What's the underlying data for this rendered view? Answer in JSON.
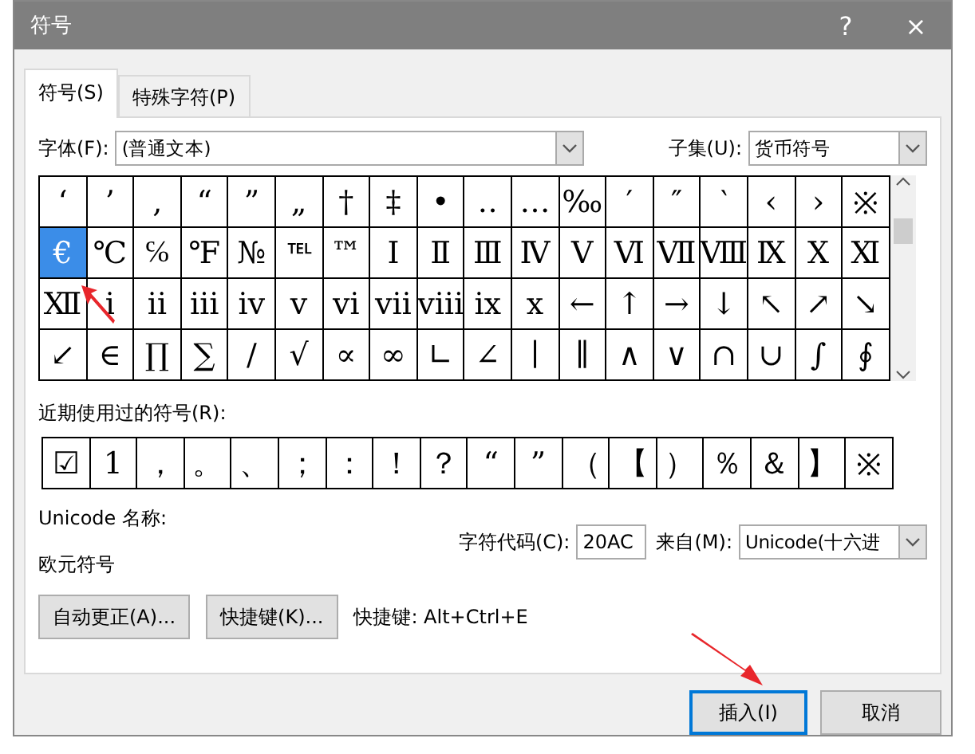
{
  "window": {
    "title": "符号",
    "help": "?",
    "close": "×"
  },
  "tabs": [
    {
      "label": "符号(S)",
      "selected": true
    },
    {
      "label": "特殊字符(P)",
      "selected": false
    }
  ],
  "font_field": {
    "label": "字体(F):",
    "value": "(普通文本)"
  },
  "subset_field": {
    "label": "子集(U):",
    "value": "货币符号"
  },
  "symbol_grid": [
    [
      {
        "char": "‘",
        "selected": false
      },
      {
        "char": "’",
        "selected": false
      },
      {
        "char": "‚",
        "selected": false
      },
      {
        "char": "“",
        "selected": false
      },
      {
        "char": "”",
        "selected": false
      },
      {
        "char": "„",
        "selected": false
      },
      {
        "char": "†",
        "selected": false
      },
      {
        "char": "‡",
        "selected": false
      },
      {
        "char": "•",
        "selected": false
      },
      {
        "char": "‥",
        "selected": false
      },
      {
        "char": "…",
        "selected": false
      },
      {
        "char": "‰",
        "selected": false
      },
      {
        "char": "′",
        "selected": false
      },
      {
        "char": "″",
        "selected": false
      },
      {
        "char": "‵",
        "selected": false
      },
      {
        "char": "‹",
        "selected": false
      },
      {
        "char": "›",
        "selected": false
      },
      {
        "char": "※",
        "selected": false
      }
    ],
    [
      {
        "char": "€",
        "selected": true
      },
      {
        "char": "℃",
        "selected": false
      },
      {
        "char": "℅",
        "selected": false
      },
      {
        "char": "℉",
        "selected": false
      },
      {
        "char": "№",
        "selected": false
      },
      {
        "char": "℡",
        "selected": false
      },
      {
        "char": "™",
        "selected": false
      },
      {
        "char": "Ⅰ",
        "selected": false
      },
      {
        "char": "Ⅱ",
        "selected": false
      },
      {
        "char": "Ⅲ",
        "selected": false
      },
      {
        "char": "Ⅳ",
        "selected": false
      },
      {
        "char": "Ⅴ",
        "selected": false
      },
      {
        "char": "Ⅵ",
        "selected": false
      },
      {
        "char": "Ⅶ",
        "selected": false
      },
      {
        "char": "Ⅷ",
        "selected": false
      },
      {
        "char": "Ⅸ",
        "selected": false
      },
      {
        "char": "Ⅹ",
        "selected": false
      },
      {
        "char": "Ⅺ",
        "selected": false
      }
    ],
    [
      {
        "char": "Ⅻ",
        "selected": false
      },
      {
        "char": "ⅰ",
        "selected": false
      },
      {
        "char": "ⅱ",
        "selected": false
      },
      {
        "char": "ⅲ",
        "selected": false
      },
      {
        "char": "ⅳ",
        "selected": false
      },
      {
        "char": "ⅴ",
        "selected": false
      },
      {
        "char": "ⅵ",
        "selected": false
      },
      {
        "char": "ⅶ",
        "selected": false
      },
      {
        "char": "ⅷ",
        "selected": false
      },
      {
        "char": "ⅸ",
        "selected": false
      },
      {
        "char": "ⅹ",
        "selected": false
      },
      {
        "char": "←",
        "selected": false
      },
      {
        "char": "↑",
        "selected": false
      },
      {
        "char": "→",
        "selected": false
      },
      {
        "char": "↓",
        "selected": false
      },
      {
        "char": "↖",
        "selected": false
      },
      {
        "char": "↗",
        "selected": false
      },
      {
        "char": "↘",
        "selected": false
      }
    ],
    [
      {
        "char": "↙",
        "selected": false
      },
      {
        "char": "∈",
        "selected": false
      },
      {
        "char": "∏",
        "selected": false
      },
      {
        "char": "∑",
        "selected": false
      },
      {
        "char": "∕",
        "selected": false
      },
      {
        "char": "√",
        "selected": false
      },
      {
        "char": "∝",
        "selected": false
      },
      {
        "char": "∞",
        "selected": false
      },
      {
        "char": "∟",
        "selected": false
      },
      {
        "char": "∠",
        "selected": false
      },
      {
        "char": "∣",
        "selected": false
      },
      {
        "char": "∥",
        "selected": false
      },
      {
        "char": "∧",
        "selected": false
      },
      {
        "char": "∨",
        "selected": false
      },
      {
        "char": "∩",
        "selected": false
      },
      {
        "char": "∪",
        "selected": false
      },
      {
        "char": "∫",
        "selected": false
      },
      {
        "char": "∮",
        "selected": false
      }
    ]
  ],
  "recent": {
    "label": "近期使用过的符号(R):",
    "symbols": [
      "☑",
      "1",
      "，",
      "。",
      "、",
      "；",
      "：",
      "！",
      "？",
      "“",
      "”",
      "（",
      "【",
      "）",
      "％",
      "＆",
      "】",
      "※"
    ]
  },
  "unicode_name": {
    "label": "Unicode 名称:",
    "value": "欧元符号"
  },
  "char_code": {
    "label": "字符代码(C):",
    "value": "20AC"
  },
  "from_field": {
    "label": "来自(M):",
    "value": "Unicode(十六进"
  },
  "autocorrect_button": "自动更正(A)...",
  "shortcut_button": "快捷键(K)...",
  "shortcut_text": "快捷键: Alt+Ctrl+E",
  "insert_button": "插入(I)",
  "cancel_button": "取消"
}
